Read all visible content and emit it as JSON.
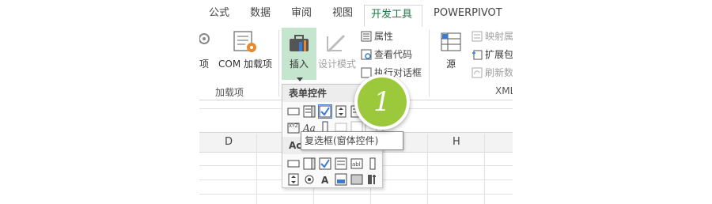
{
  "tabs": [
    "公式",
    "数据",
    "审阅",
    "视图",
    "开发工具",
    "POWERPIVOT"
  ],
  "ribbon": {
    "addins_partial_label": "项",
    "com_addins_label": "COM 加载项",
    "addins_group_label": "加载项",
    "insert_label": "插入",
    "design_mode_label": "设计模式",
    "properties_label": "属性",
    "view_code_label": "查看代码",
    "run_dialog_partial_label": "执行对话框",
    "source_label": "源",
    "map_properties_partial_label": "映射属",
    "expansion_packs_partial_label": "扩展包",
    "refresh_data_partial_label": "刷新数",
    "xml_group_label": "XML"
  },
  "dropdown": {
    "form_controls_header": "表单控件",
    "activex_header_partial": "ActiveX"
  },
  "tooltip": "复选框(窗体控件)",
  "callout_number": "1",
  "sheet": {
    "columns": [
      "D",
      "H"
    ]
  },
  "colors": {
    "accent": "#217346",
    "insert_highlight": "#c6e5cf",
    "callout": "#9cc83c"
  }
}
